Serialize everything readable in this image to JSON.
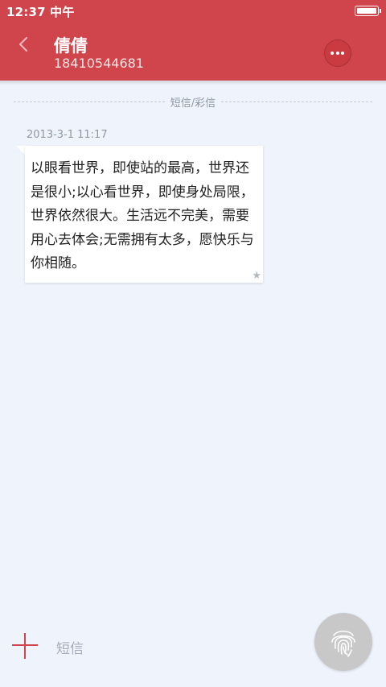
{
  "status_bar": {
    "time": "12:37 中午"
  },
  "header": {
    "contact_name": "倩倩",
    "contact_number": "18410544681",
    "back_icon": "chevron-left-icon",
    "more_icon": "more-horizontal-icon"
  },
  "conversation": {
    "divider_label": "短信/彩信",
    "messages": [
      {
        "timestamp": "2013-3-1 11:17",
        "text": "以眼看世界，即使站的最高，世界还是很小;以心看世界，即使身处局限，世界依然很大。生活远不完美，需要用心去体会;无需拥有太多，愿快乐与你相随。",
        "starred_icon": "star-icon"
      }
    ]
  },
  "composer": {
    "add_icon": "plus-icon",
    "placeholder": "短信",
    "fingerprint_icon": "fingerprint-icon"
  },
  "colors": {
    "header_bg": "#d0454b",
    "page_bg": "#eff4fc",
    "accent": "#d0454b"
  }
}
